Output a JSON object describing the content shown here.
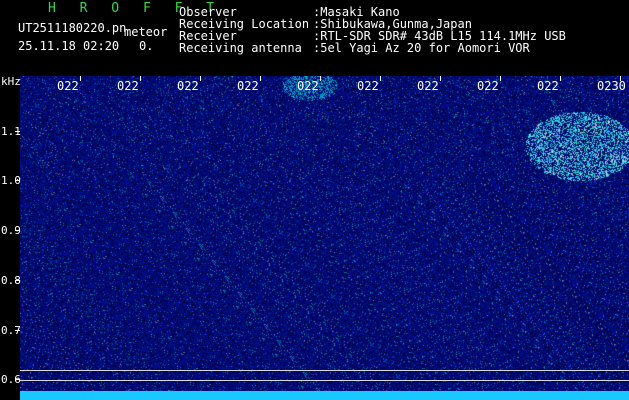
{
  "header": {
    "title_letters": "H R O F F T",
    "filename": "UT2511180220.pn",
    "mode": "meteor",
    "datetime": "25.11.18 02:20",
    "count": "0.",
    "info_labels": [
      "Observer",
      "Receiving Location",
      "Receiver",
      "Receiving antenna"
    ],
    "info_values": [
      ":Masaki Kano",
      ":Shibukawa,Gunma,Japan",
      ":RTL-SDR SDR# 43dB L15 114.1MHz USB",
      ":5el Yagi Az 20 for Aomori VOR"
    ]
  },
  "yaxis": {
    "unit": "kHz",
    "ticks": [
      "1.1",
      "1.0",
      "0.9",
      "0.8",
      "0.7",
      "0.6"
    ]
  },
  "time_labels": [
    "022",
    "022",
    "022",
    "022",
    "022",
    "022",
    "022",
    "022",
    "022",
    "0230"
  ],
  "colors": {
    "background": "#000000",
    "spectrogram_base": "#020a50",
    "signal": "#18c8ff",
    "title": "#39d44a"
  }
}
